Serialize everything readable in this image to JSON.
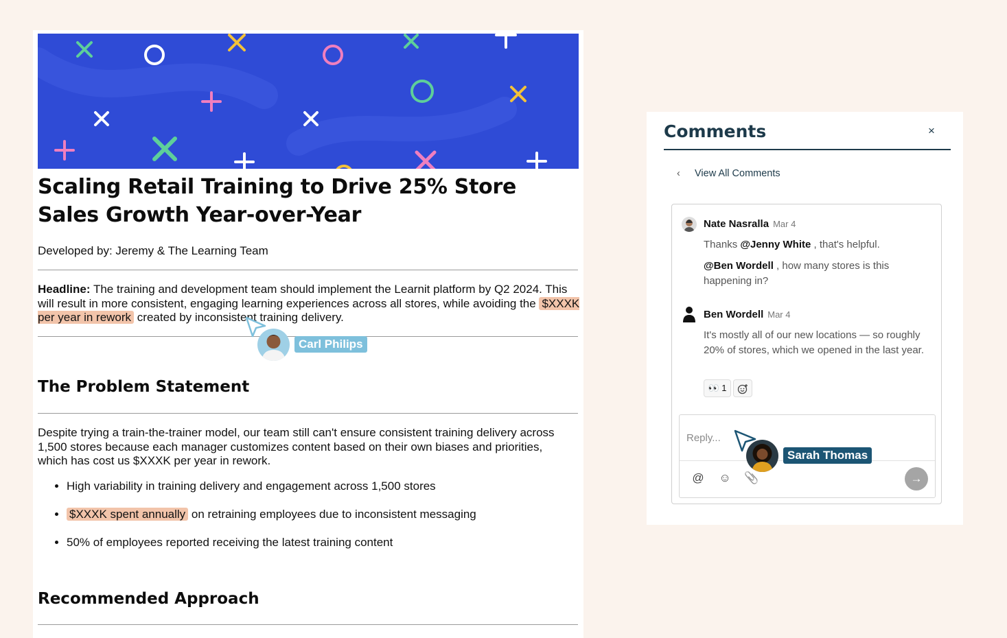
{
  "document": {
    "title": "Scaling Retail Training to Drive 25% Store Sales Growth Year-over-Year",
    "byline": "Developed by: Jeremy & The Learning Team",
    "headline": {
      "label": "Headline:",
      "text_before": " The training and development team should implement the Learnit platform by Q2 2024. This will result in more consistent, engaging learning experiences across all stores, while avoiding the",
      "highlight": "$XXXK per year in rework",
      "text_after": " created by inconsistent training delivery."
    },
    "problem": {
      "heading": "The Problem Statement",
      "paragraph": "Despite trying a train-the-trainer model, our team still can't ensure consistent training delivery across 1,500 stores because each manager customizes content based on their own biases and priorities, which has cost us $XXXK per year in rework.",
      "bullets": {
        "b1": "High variability in training delivery and engagement across 1,500 stores",
        "b2_highlight": "$XXXK spent annually",
        "b2_rest": " on retraining employees due to inconsistent messaging",
        "b3": "50% of employees reported receiving the latest training content"
      }
    },
    "approach_heading": "Recommended Approach"
  },
  "collaborators": {
    "carl": {
      "name": "Carl Philips",
      "color": "#7ec0dc"
    },
    "sarah": {
      "name": "Sarah Thomas",
      "color": "#1c5574"
    }
  },
  "comments": {
    "title": "Comments",
    "close_glyph": "×",
    "back_label": "View All Comments",
    "back_glyph": "‹",
    "thread": {
      "c1": {
        "author": "Nate Nasralla",
        "date": "Mar 4",
        "p1_pre": "Thanks ",
        "p1_mention": "@Jenny White",
        "p1_post": " , that's helpful.",
        "p2_mention": "@Ben Wordell",
        "p2_post": " , how many stores is this happening in?"
      },
      "c2": {
        "author": "Ben Wordell",
        "date": "Mar 4",
        "body": "It's mostly all of our new locations — so roughly 20% of stores, which we opened in the last year.",
        "reaction_emoji": "👀",
        "reaction_count": "1"
      }
    },
    "reply": {
      "placeholder": "Reply...",
      "mention_glyph": "@",
      "emoji_glyph": "☺",
      "attach_glyph": "📎",
      "send_glyph": "→"
    }
  },
  "colors": {
    "page_bg": "#fbf3ed",
    "banner": "#2f4bd6",
    "highlight": "#f2c4aa",
    "panel_accent": "#1d3a4a"
  }
}
